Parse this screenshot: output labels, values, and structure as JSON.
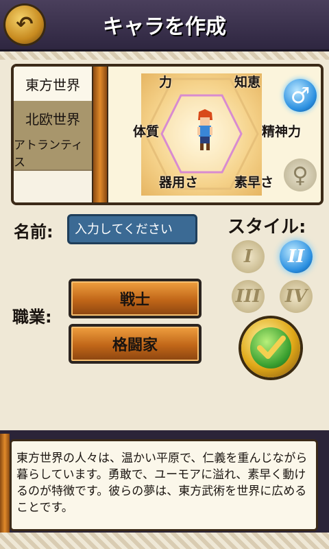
{
  "header": {
    "title": "キャラを作成",
    "back_icon": "back-arrow-icon"
  },
  "tabs": [
    {
      "label": "東方世界",
      "selected": true
    },
    {
      "label": "北欧世界",
      "selected": false
    },
    {
      "label": "アトランティス",
      "selected": false
    }
  ],
  "stats": {
    "power": "力",
    "wisdom": "知恵",
    "vitality": "体質",
    "spirit": "精神力",
    "dexterity": "器用さ",
    "agility": "素早さ"
  },
  "gender": {
    "male_symbol": "♂",
    "female_symbol": "♀",
    "selected": "male"
  },
  "name": {
    "label": "名前:",
    "placeholder": "入力してください"
  },
  "style": {
    "label": "スタイル:",
    "options": [
      {
        "label": "I",
        "selected": false
      },
      {
        "label": "II",
        "selected": true
      },
      {
        "label": "III",
        "selected": false
      },
      {
        "label": "IV",
        "selected": false
      }
    ]
  },
  "job": {
    "label": "職業:",
    "class": "戦士",
    "subclass": "格闘家"
  },
  "confirm_icon": "checkmark-icon",
  "description": "東方世界の人々は、温かい平原で、仁義を重んじながら暮らしています。勇敢で、ユーモアに溢れ、素早く動けるのが特徴です。彼らの夢は、東方武術を世界に広めることです。",
  "colors": {
    "accent_blue": "#2a8fe0",
    "gold": "#e0a818",
    "wood": "#c06618"
  }
}
